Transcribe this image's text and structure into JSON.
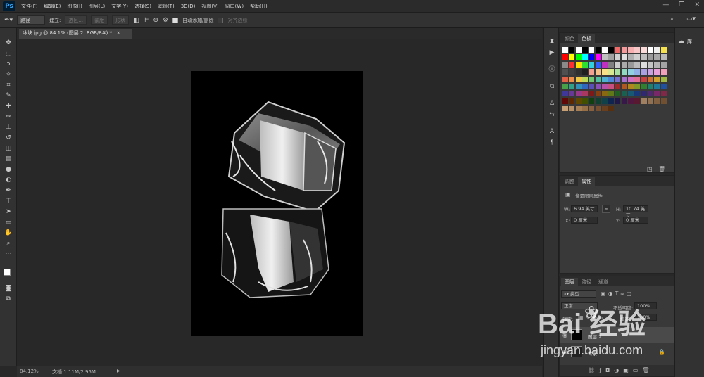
{
  "app": {
    "logo": "Ps"
  },
  "menu": [
    "文件(F)",
    "编辑(E)",
    "图像(I)",
    "图层(L)",
    "文字(Y)",
    "选择(S)",
    "滤镜(T)",
    "3D(D)",
    "视图(V)",
    "窗口(W)",
    "帮助(H)"
  ],
  "window_buttons": [
    "—",
    "❐",
    "✕"
  ],
  "options": {
    "mode_value": "路径",
    "create_label": "建立:",
    "selection_btn": "选区...",
    "mask_btn": "蒙版",
    "shape_btn": "形状",
    "auto_add_label": "自动添加/删除",
    "align_edges_label": "对齐边缘"
  },
  "document_tab": {
    "title": "冰块.jpg @ 84.1% (图层 2, RGB/8#) *",
    "close": "×"
  },
  "status": {
    "zoom": "84.12%",
    "doc": "文档:1.11M/2.95M",
    "arrow": "▶"
  },
  "panels": {
    "swatches": {
      "tabs": [
        "颜色",
        "色板"
      ],
      "active": 1
    },
    "properties": {
      "tabs": [
        "调整",
        "属性"
      ],
      "active": 1,
      "section_title": "像素图层属性",
      "w_label": "W:",
      "w_value": "6.94 英寸",
      "h_label": "H:",
      "h_value": "10.74 英寸",
      "x_label": "X:",
      "x_value": "0 厘米",
      "y_label": "Y:",
      "y_value": "0 厘米"
    },
    "layers": {
      "tabs": [
        "图层",
        "路径",
        "通道"
      ],
      "active": 0,
      "filter_kind": "类型",
      "blend_mode": "正常",
      "opacity_label": "不透明度:",
      "opacity_value": "100%",
      "lock_label": "锁定:",
      "fill_label": "填充:",
      "fill_value": "100%",
      "layer_items": [
        "图层 2",
        "背景"
      ]
    },
    "libraries": {
      "label": "库"
    }
  },
  "watermark": {
    "brand": "Bai  经验",
    "url": "jingyan.baidu.com"
  },
  "colors": {
    "swatch_rows": [
      [
        "#ffffff",
        "#000000",
        "#ffffff",
        "#000000",
        "#ffffff",
        "#000000",
        "#ffffff",
        "#000000",
        "#f06a6a",
        "#f59a9a",
        "#f7b0b0",
        "#f8c8c8",
        "#fbdada",
        "#fff",
        "#f0f0f0",
        "#f5e050"
      ],
      [
        "#ff0000",
        "#ffff00",
        "#00ff00",
        "#00ffff",
        "#0000ff",
        "#ff00ff",
        "#c0c0c0",
        "#a0a0a0",
        "#d0d0d0",
        "#e0e0e0",
        "#b0b0b0",
        "#cfcfcf",
        "#bdbdbd",
        "#9a9a9a",
        "#a8a8a8",
        "#b8b8b8"
      ],
      [
        "#8a8a8a",
        "#ff3030",
        "#ffe000",
        "#30e030",
        "#30d0e0",
        "#3060ff",
        "#c030c0",
        "#808080",
        "#cccccc",
        "#aaaaaa",
        "#999999",
        "#bbbbbb",
        "#dddddd",
        "#c4c4c4",
        "#b4b4b4",
        "#a4a4a4"
      ],
      [
        "#505050",
        "#404040",
        "#303030",
        "#202020",
        "#f4a090",
        "#f8c088",
        "#f8e088",
        "#d8e890",
        "#a8e0a0",
        "#90d8c0",
        "#90d0e0",
        "#90b0e8",
        "#a8a0e0",
        "#c8a0e0",
        "#e8a0d8",
        "#f0a0b8"
      ],
      [
        "#e06048",
        "#f09048",
        "#f0c848",
        "#c0d858",
        "#70c870",
        "#50c0a0",
        "#50b0d0",
        "#5088d8",
        "#7870d0",
        "#a870d0",
        "#d070c0",
        "#e07098",
        "#c84040",
        "#d07030",
        "#d0a030",
        "#a0b840"
      ],
      [
        "#48a048",
        "#30a088",
        "#3090b8",
        "#3068c0",
        "#5850b8",
        "#8850b8",
        "#b850a8",
        "#c85080",
        "#a02828",
        "#b05820",
        "#b08820",
        "#809828",
        "#308030",
        "#208070",
        "#207898",
        "#2050a0"
      ],
      [
        "#403898",
        "#683898",
        "#983888",
        "#a83860",
        "#801818",
        "#884010",
        "#886810",
        "#607818",
        "#206020",
        "#186050",
        "#185870",
        "#183878",
        "#302870",
        "#502870",
        "#782868",
        "#802848"
      ],
      [
        "#600808",
        "#602800",
        "#604800",
        "#405000",
        "#104010",
        "#104030",
        "#104048",
        "#102450",
        "#201848",
        "#381848",
        "#501840",
        "#581830",
        "#a08060",
        "#907050",
        "#806040",
        "#705030"
      ],
      [
        "#c8a078",
        "#b89068",
        "#a88058",
        "#987048",
        "#886040",
        "#785030",
        "#684020",
        "#583010"
      ]
    ]
  }
}
